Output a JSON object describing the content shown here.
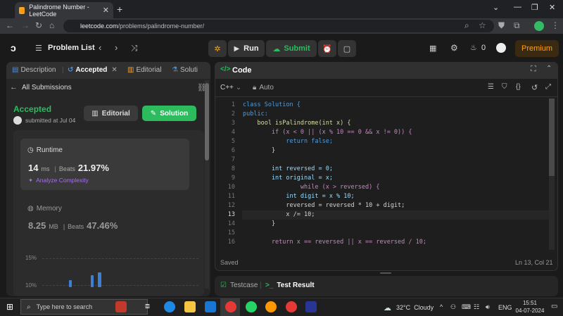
{
  "browser": {
    "tab_title": "Palindrome Number - LeetCode",
    "url_host": "leetcode.com",
    "url_path": "/problems/palindrome-number/"
  },
  "topbar": {
    "problem_list": "Problem List",
    "run": "Run",
    "submit": "Submit",
    "streak": "0",
    "premium": "Premium"
  },
  "left": {
    "tabs": [
      "Description",
      "Accepted",
      "Editorial",
      "Soluti"
    ],
    "all_submissions": "All Submissions",
    "status": "Accepted",
    "submitted": "submitted at Jul 0⁠4",
    "editorial_btn": "Editorial",
    "solution_btn": "Solution",
    "runtime": {
      "label": "Runtime",
      "value": "14",
      "unit": "ms",
      "beats_label": "Beats",
      "beats": "21.97%",
      "analyze": "Analyze Complexity"
    },
    "memory": {
      "label": "Memory",
      "value": "8.25",
      "unit": "MB",
      "beats_label": "Beats",
      "beats": "47.46%"
    },
    "chart_ticks": [
      "15%",
      "10%"
    ]
  },
  "editor": {
    "title": "Code",
    "lang": "C++",
    "auto": "Auto",
    "saved": "Saved",
    "cursor": "Ln 13, Col 21",
    "line_numbers": [
      "1",
      "2",
      "3",
      "4",
      "5",
      "6",
      "7",
      "8",
      "9",
      "10",
      "11",
      "12",
      "13",
      "14",
      "15",
      "16"
    ],
    "lines": [
      "class Solution {",
      "public:",
      "    bool isPalindrome(int x) {",
      "        if (x < 0 || (x % 10 == 0 && x != 0)) {",
      "            return false;",
      "        }",
      "",
      "        int reversed = 0;",
      "        int original = x;",
      "                while (x > reversed) {",
      "            int digit = x % 10;",
      "            reversed = reversed * 10 + digit;",
      "            x /= 10;",
      "        }",
      "",
      "        return x == reversed || x == reversed / 10;"
    ]
  },
  "bottom": {
    "testcase": "Testcase",
    "test_result": "Test Result"
  },
  "taskbar": {
    "search": "Type here to search",
    "weather": "32°C  Cloudy",
    "lang": "ENG",
    "time": "15:51",
    "date": "04-07-2024"
  }
}
